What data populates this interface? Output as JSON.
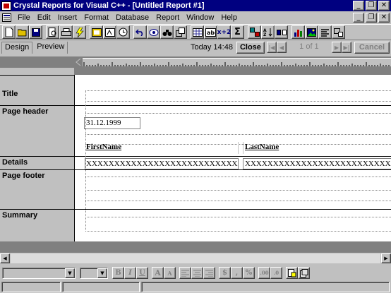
{
  "window": {
    "title": "Crystal Reports for Visual C++ - [Untitled Report #1]",
    "controls": [
      "_",
      "❐",
      "✕"
    ]
  },
  "menu": {
    "items": [
      {
        "label": "File",
        "mnemonic": "F"
      },
      {
        "label": "Edit",
        "mnemonic": "E"
      },
      {
        "label": "Insert",
        "mnemonic": "I"
      },
      {
        "label": "Format",
        "mnemonic": "m"
      },
      {
        "label": "Database",
        "mnemonic": "D"
      },
      {
        "label": "Report",
        "mnemonic": "R"
      },
      {
        "label": "Window",
        "mnemonic": "W"
      },
      {
        "label": "Help",
        "mnemonic": "H"
      }
    ],
    "doc_controls": [
      "_",
      "❐",
      "✕"
    ]
  },
  "toolbar": {
    "buttons": [
      {
        "icon": "new-icon"
      },
      {
        "icon": "open-icon"
      },
      {
        "icon": "save-icon"
      },
      {
        "icon": "print-preview-icon"
      },
      {
        "icon": "print-icon"
      },
      {
        "icon": "export-icon"
      },
      {
        "icon": "database-icon"
      },
      {
        "icon": "formula-icon"
      },
      {
        "icon": "refresh-icon"
      },
      {
        "icon": "undo-icon"
      },
      {
        "icon": "zoom-icon"
      },
      {
        "icon": "find-icon"
      },
      {
        "icon": "resize-icon"
      },
      {
        "icon": "insert-database-field-icon"
      },
      {
        "icon": "insert-text-icon"
      },
      {
        "icon": "insert-formula-icon",
        "label": "x+2"
      },
      {
        "icon": "insert-summary-icon",
        "label": "Σ"
      },
      {
        "icon": "select-expert-icon"
      },
      {
        "icon": "sort-icon"
      },
      {
        "icon": "group-icon"
      },
      {
        "icon": "chart-icon"
      },
      {
        "icon": "picture-icon"
      },
      {
        "icon": "align-icon"
      },
      {
        "icon": "box-icon"
      }
    ]
  },
  "navigation": {
    "tabs": [
      {
        "label": "Design",
        "active": true
      },
      {
        "label": "Preview",
        "active": false
      }
    ],
    "timestamp": "Today 14:48",
    "close_label": "Close",
    "page_counter": "1 of 1",
    "cancel_label": "Cancel"
  },
  "sections": [
    {
      "label": "Title"
    },
    {
      "label": "Page header"
    },
    {
      "label": "Details"
    },
    {
      "label": "Page footer"
    },
    {
      "label": "Summary"
    }
  ],
  "report": {
    "date_field": "31.12.1999",
    "headers": [
      "FirstName",
      "LastName"
    ],
    "details": [
      "XXXXXXXXXXXXXXXXXXXXXXXXXXXXXX",
      "XXXXXXXXXXXXXXXXXXXXXXXXXXXXXXXX"
    ]
  },
  "format_bar": {
    "font_name": "",
    "font_size": "",
    "buttons": [
      "B",
      "I",
      "U",
      "A",
      "A"
    ]
  },
  "colors": {
    "titlebar": "#000080",
    "face": "#c0c0c0",
    "workspace": "#808080"
  }
}
